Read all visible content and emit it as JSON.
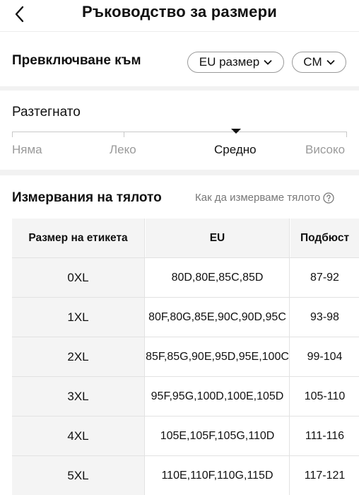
{
  "header": {
    "title": "Ръководство за размери",
    "back_icon": "chevron-left-icon"
  },
  "switch": {
    "label": "Превключване към",
    "size_system": "EU размер",
    "unit": "CM"
  },
  "stretch": {
    "title": "Разтегнато",
    "options": [
      "Няма",
      "Леко",
      "Средно",
      "Високо"
    ],
    "selected": "Средно"
  },
  "measurements": {
    "title": "Измервания на тялото",
    "how_to": "Как да измерваме тялото"
  },
  "table": {
    "headers": [
      "Размер на етикета",
      "EU",
      "Подбюст"
    ],
    "rows": [
      [
        "0XL",
        "80D,80E,85C,85D",
        "87-92"
      ],
      [
        "1XL",
        "80F,80G,85E,90C,90D,95C",
        "93-98"
      ],
      [
        "2XL",
        "85F,85G,90E,95D,95E,100C",
        "99-104"
      ],
      [
        "3XL",
        "95F,95G,100D,100E,105D",
        "105-110"
      ],
      [
        "4XL",
        "105E,105F,105G,110D",
        "111-116"
      ],
      [
        "5XL",
        "110E,110F,110G,115D",
        "117-121"
      ]
    ]
  }
}
